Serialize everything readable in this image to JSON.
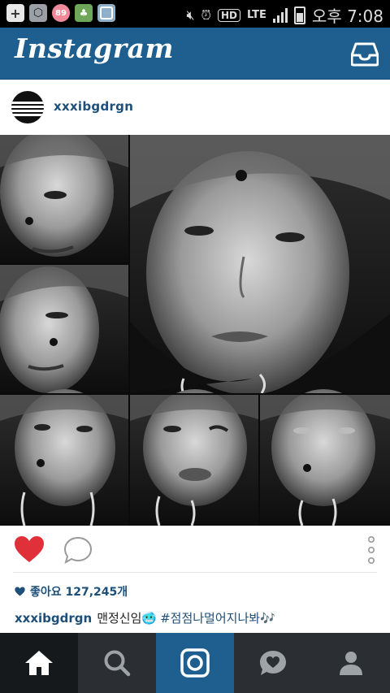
{
  "status_bar": {
    "badge_count": "89",
    "hd_label": "HD",
    "network_label": "LTE",
    "time": "오후 7:08"
  },
  "header": {
    "logo": "Instagram",
    "inbox_icon": "inbox-icon"
  },
  "post": {
    "username": "xxxibgdrgn",
    "liked": true,
    "likes_text": "좋아요 127,245개",
    "caption_user": "xxxibgdrgn",
    "caption_text": "맨정신임🥶",
    "caption_hashtag": "#점점나멀어지나봐🎶"
  },
  "nav": {
    "items": [
      "home-icon",
      "search-icon",
      "camera-icon",
      "activity-icon",
      "profile-icon"
    ],
    "selected": "home-icon"
  },
  "colors": {
    "brand_blue": "#1f5f8f",
    "like_red": "#e0303a",
    "nav_bg": "#2b2f33"
  }
}
